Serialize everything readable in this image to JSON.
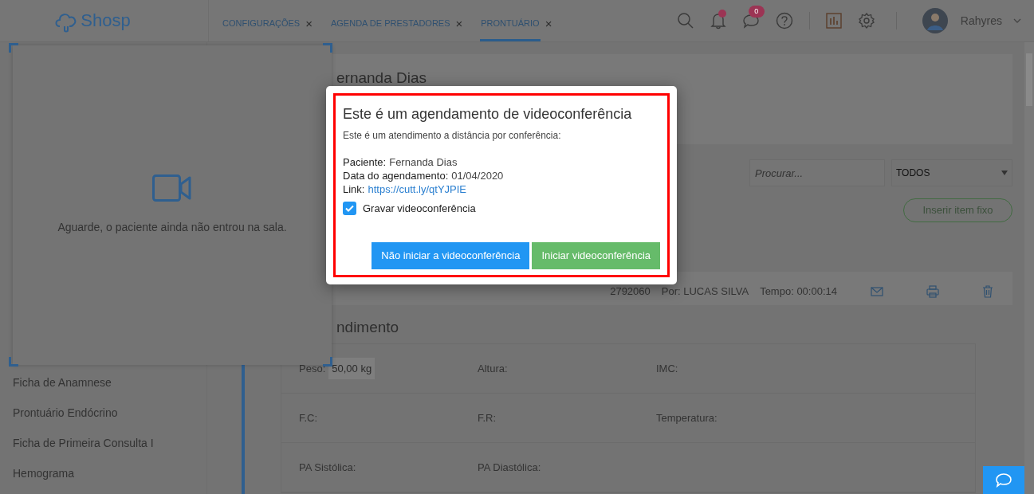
{
  "header": {
    "logo": "Shosp",
    "tabs": [
      {
        "label": "CONFIGURAÇÕES",
        "close": "×",
        "selected": false
      },
      {
        "label": "AGENDA DE PRESTADORES",
        "close": "×",
        "selected": false
      },
      {
        "label": "PRONTUÁRIO",
        "close": "×",
        "selected": true
      }
    ],
    "messages_badge": "0",
    "user": "Rahyres"
  },
  "sidebar": {
    "items": [
      {
        "label": "Ficha de Anamnese"
      },
      {
        "label": "Prontuário Endócrino"
      },
      {
        "label": "Ficha de Primeira Consulta I"
      },
      {
        "label": "Hemograma"
      }
    ]
  },
  "patient": {
    "name": "ernanda Dias"
  },
  "filters": {
    "search": {
      "placeholder": "Procurar..."
    },
    "select": {
      "value": "TODOS"
    }
  },
  "insert_button": "Inserir item fixo",
  "record": {
    "id": "2792060",
    "by": "Por: LUCAS SILVA",
    "time": "Tempo: 00:00:14"
  },
  "section_title": "ndimento",
  "vitals": [
    [
      {
        "label": "Peso:",
        "value": "50,00 kg"
      },
      {
        "label": "Altura:"
      },
      {
        "label": "IMC:"
      }
    ],
    [
      {
        "label": "F.C:"
      },
      {
        "label": "F.R:"
      },
      {
        "label": "Temperatura:"
      }
    ],
    [
      {
        "label": "PA Sistólica:"
      },
      {
        "label": "PA Diastólica:"
      }
    ]
  ],
  "video_panel": {
    "message": "Aguarde, o paciente ainda não entrou na sala."
  },
  "modal": {
    "title": "Este é um agendamento de videoconferência",
    "subtitle": "Este é um atendimento a distância por conferência:",
    "fields": [
      {
        "label": "Paciente:",
        "value": "Fernanda Dias",
        "kind": "text"
      },
      {
        "label": "Data do agendamento:",
        "value": "01/04/2020",
        "kind": "text"
      },
      {
        "label": "Link:",
        "value": "https://cutt.ly/qtYJPIE",
        "kind": "link"
      }
    ],
    "checkbox": {
      "label": "Gravar videoconferência",
      "checked": true
    },
    "buttons": [
      {
        "label": "Não iniciar a videoconferência",
        "kind": "secondary"
      },
      {
        "label": "Iniciar videoconferência",
        "kind": "primary"
      }
    ]
  }
}
